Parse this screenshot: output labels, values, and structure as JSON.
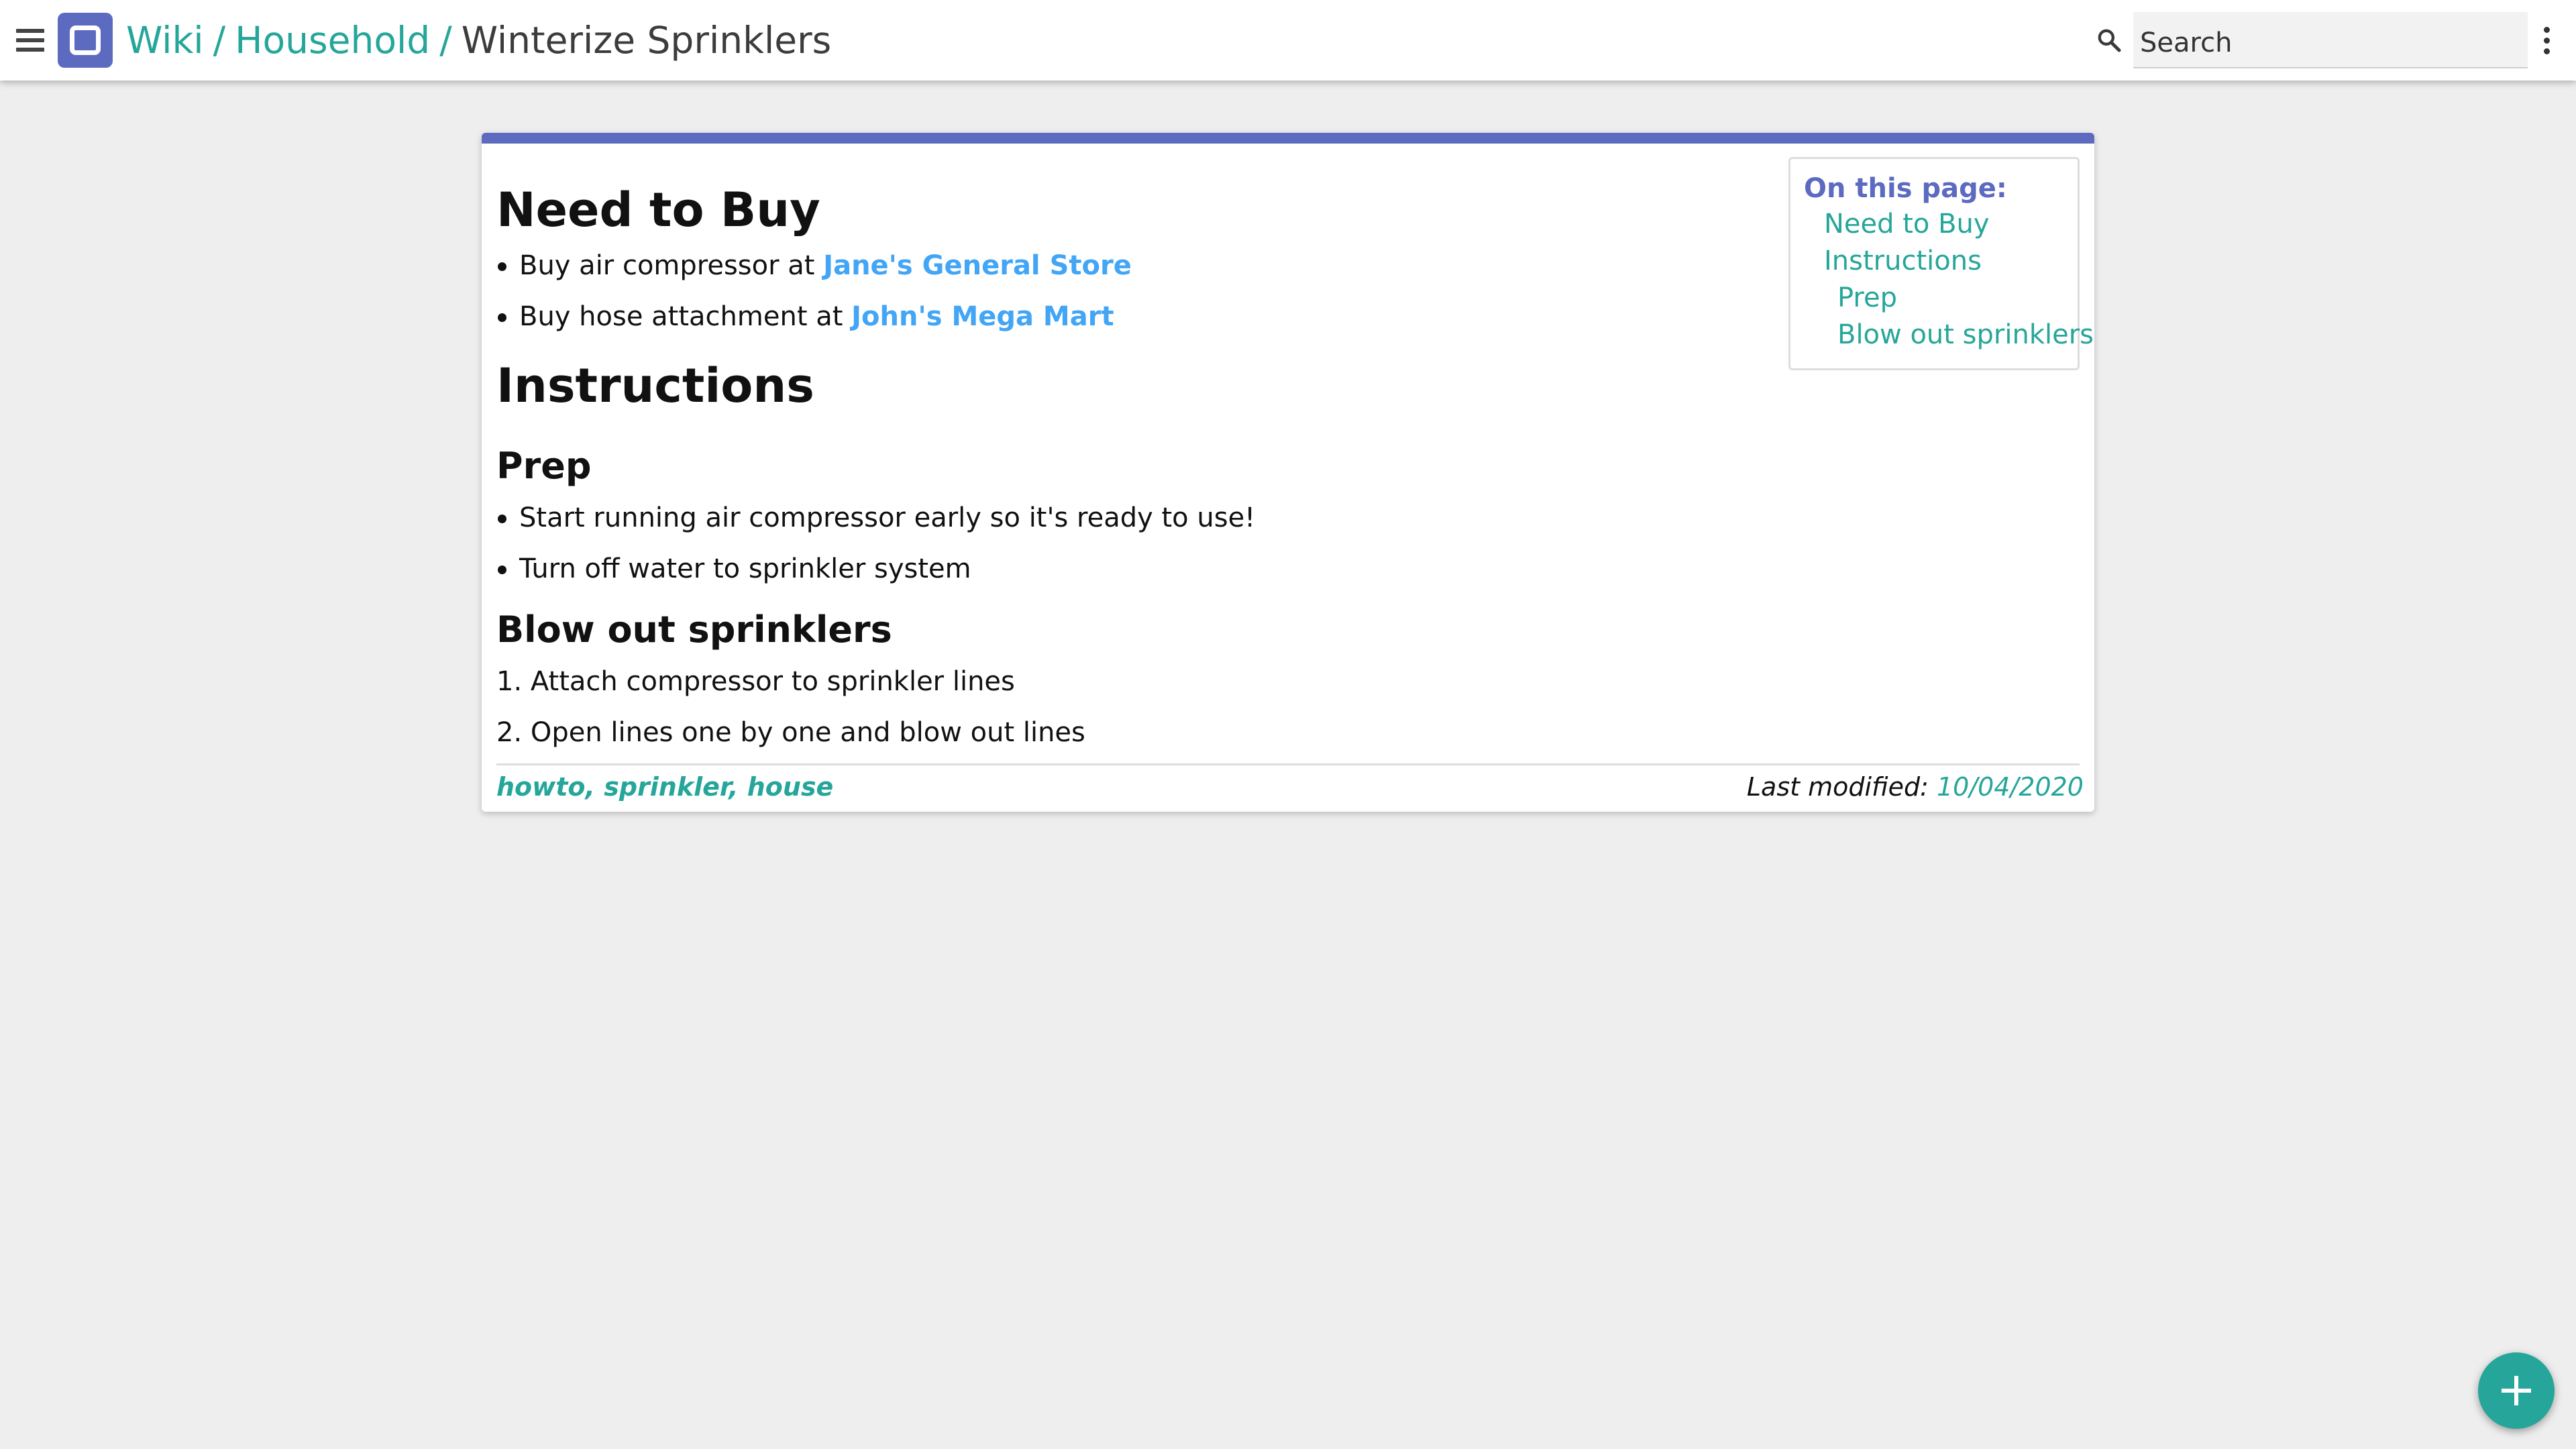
{
  "header": {
    "breadcrumb": {
      "root": "Wiki",
      "parent": "Household",
      "separator": "/",
      "current": "Winterize Sprinklers"
    },
    "search": {
      "placeholder": "Search",
      "value": ""
    },
    "icons": {
      "menu": "menu-icon",
      "logo": "app-logo-icon",
      "search": "search-icon",
      "more": "more-vert-icon"
    }
  },
  "toc": {
    "title": "On this page:",
    "items": [
      {
        "label": "Need to Buy",
        "level": 1
      },
      {
        "label": "Instructions",
        "level": 1
      },
      {
        "label": "Prep",
        "level": 2
      },
      {
        "label": "Blow out sprinklers",
        "level": 2
      }
    ]
  },
  "article": {
    "need_to_buy": {
      "heading": "Need to Buy",
      "items": [
        {
          "text": "Buy air compressor at ",
          "link": "Jane's General Store"
        },
        {
          "text": "Buy hose attachment at ",
          "link": "John's Mega Mart"
        }
      ]
    },
    "instructions": {
      "heading": "Instructions",
      "prep": {
        "heading": "Prep",
        "items": [
          "Start running air compressor early so it's ready to use!",
          "Turn off water to sprinkler system"
        ]
      },
      "blow_out": {
        "heading": "Blow out sprinklers",
        "steps": [
          "1. Attach compressor to sprinkler lines",
          "2. Open lines one by one and blow out lines"
        ]
      }
    },
    "footer": {
      "tags": "howto, sprinkler, house",
      "modified_label": "Last modified: ",
      "modified_date": "10/04/2020"
    }
  },
  "fab": {
    "icon": "plus-icon"
  },
  "colors": {
    "accent": "#5c6bc0",
    "link_teal": "#26a69a",
    "link_blue": "#42a5f5",
    "background": "#eeeeee"
  }
}
